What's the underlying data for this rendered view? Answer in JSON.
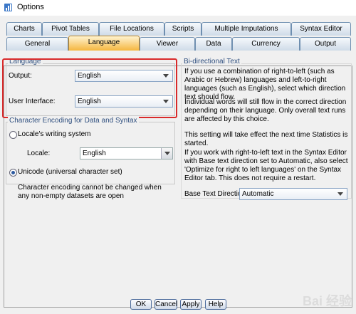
{
  "window": {
    "title": "Options"
  },
  "tabs_row1": [
    {
      "label": "Charts"
    },
    {
      "label": "Pivot Tables"
    },
    {
      "label": "File Locations"
    },
    {
      "label": "Scripts"
    },
    {
      "label": "Multiple Imputations"
    },
    {
      "label": "Syntax Editor"
    }
  ],
  "tabs_row2": [
    {
      "label": "General"
    },
    {
      "label": "Language"
    },
    {
      "label": "Viewer"
    },
    {
      "label": "Data"
    },
    {
      "label": "Currency"
    },
    {
      "label": "Output"
    }
  ],
  "language": {
    "group_label": "Language",
    "output_label": "Output:",
    "output_value": "English",
    "ui_label": "User Interface:",
    "ui_value": "English"
  },
  "encoding": {
    "group_label": "Character Encoding for Data and Syntax",
    "locale_option": "Locale's writing system",
    "locale_label": "Locale:",
    "locale_value": "English",
    "unicode_option": "Unicode (universal character set)",
    "note": "Character encoding cannot be changed when any non-empty datasets are open"
  },
  "bidi": {
    "group_label": "Bi-directional Text",
    "p1": "If you use a combination of right-to-left (such as Arabic or Hebrew) languages and left-to-right languages (such as English), select which direction text should flow.",
    "p2": "Individual words will still flow in the correct direction depending on their language. Only overall text runs are affected by this choice.",
    "p3": "This setting will take effect the next time Statistics is started.",
    "p4": "If you work with right-to-left text in the Syntax Editor with Base text direction set to Automatic, also select 'Optimize for right to left languages' on the Syntax Editor tab. This does not require a restart.",
    "direction_label": "Base Text Direction:",
    "direction_value": "Automatic"
  },
  "buttons": {
    "ok": "OK",
    "cancel": "Cancel",
    "apply": "Apply",
    "help": "Help"
  },
  "watermark": "Bai 经验"
}
